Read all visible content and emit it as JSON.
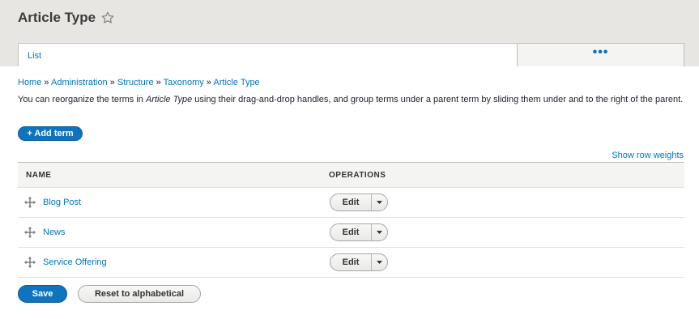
{
  "page": {
    "title": "Article Type"
  },
  "tabs": {
    "list_label": "List",
    "more_label": "•••"
  },
  "breadcrumb": {
    "items": [
      "Home",
      "Administration",
      "Structure",
      "Taxonomy",
      "Article Type"
    ],
    "separator": "»"
  },
  "description": {
    "before": "You can reorganize the terms in ",
    "emphasis": "Article Type",
    "after": " using their drag-and-drop handles, and group terms under a parent term by sliding them under and to the right of the parent."
  },
  "actions": {
    "add_term_label": "+ Add term",
    "show_row_weights_label": "Show row weights"
  },
  "table": {
    "headers": {
      "name": "NAME",
      "operations": "OPERATIONS"
    },
    "rows": [
      {
        "name": "Blog Post",
        "edit_label": "Edit"
      },
      {
        "name": "News",
        "edit_label": "Edit"
      },
      {
        "name": "Service Offering",
        "edit_label": "Edit"
      }
    ]
  },
  "footer": {
    "save_label": "Save",
    "reset_label": "Reset to alphabetical"
  },
  "colors": {
    "accent": "#0074bd",
    "primary_button": "#0f74bd",
    "header_bg": "#e7e6e2"
  }
}
